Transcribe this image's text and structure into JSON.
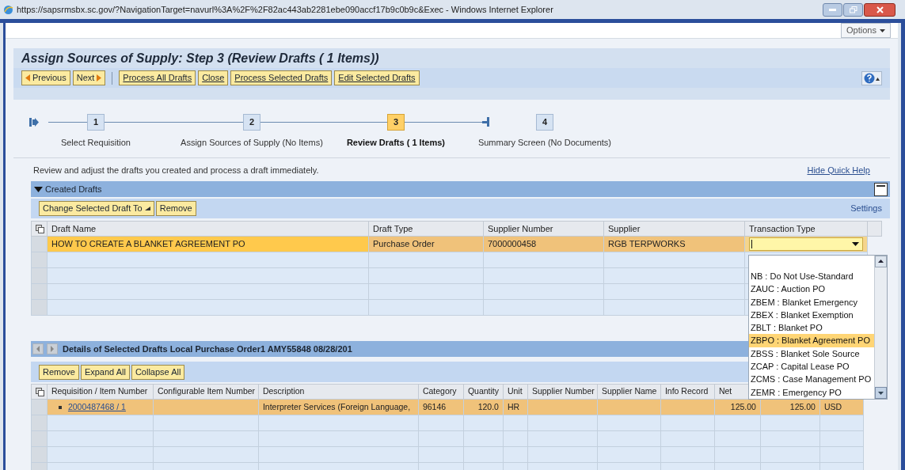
{
  "window": {
    "title": "https://sapsrmsbx.sc.gov/?NavigationTarget=navurl%3A%2F%2F82ac443ab2281ebe090accf17b9c0b9c&Exec - Windows Internet Explorer"
  },
  "options_button": "Options",
  "page_title": "Assign Sources of Supply: Step 3 (Review Drafts ( 1 Items))",
  "toolbar": [
    {
      "label": "Previous",
      "kind": "prev"
    },
    {
      "label": "Next",
      "kind": "next"
    },
    {
      "label": "Process All Drafts",
      "kind": "action"
    },
    {
      "label": "Close",
      "kind": "action"
    },
    {
      "label": "Process Selected Drafts",
      "kind": "action"
    },
    {
      "label": "Edit Selected Drafts",
      "kind": "action"
    }
  ],
  "steps": [
    {
      "number": "1",
      "label": "Select Requisition",
      "selected": false
    },
    {
      "number": "2",
      "label": "Assign Sources of Supply (No Items)",
      "selected": false
    },
    {
      "number": "3",
      "label": "Review Drafts ( 1 Items)",
      "selected": true
    },
    {
      "number": "4",
      "label": "Summary Screen (No Documents)",
      "selected": false
    }
  ],
  "quick_help": {
    "text": "Review and adjust the drafts you created and process a draft immediately.",
    "link": "Hide Quick Help"
  },
  "created_drafts": {
    "title": "Created Drafts",
    "expanded": true,
    "toolbar": [
      {
        "label": "Change Selected Draft To",
        "kind": "menu"
      },
      {
        "label": "Remove",
        "kind": "action"
      }
    ],
    "settings_link": "Settings",
    "columns": [
      "Draft Name",
      "Draft Type",
      "Supplier Number",
      "Supplier",
      "Transaction Type"
    ],
    "rows": [
      {
        "draft_name": "HOW TO CREATE A BLANKET AGREEMENT PO",
        "draft_type": "Purchase Order",
        "supplier_number": "7000000458",
        "supplier": "RGB TERPWORKS",
        "selected": true
      }
    ]
  },
  "transaction_dropdown": {
    "options": [
      {
        "label": "NB : Do Not Use-Standard",
        "selected": false
      },
      {
        "label": "ZAUC : Auction PO",
        "selected": false
      },
      {
        "label": "ZBEM : Blanket Emergency",
        "selected": false
      },
      {
        "label": "ZBEX : Blanket Exemption",
        "selected": false
      },
      {
        "label": "ZBLT : Blanket PO",
        "selected": false
      },
      {
        "label": "ZBPO : Blanket Agreement PO",
        "selected": true
      },
      {
        "label": "ZBSS : Blanket Sole Source",
        "selected": false
      },
      {
        "label": "ZCAP : Capital Lease PO",
        "selected": false
      },
      {
        "label": "ZCMS : Case Management PO",
        "selected": false
      },
      {
        "label": "ZEMR : Emergency PO",
        "selected": false
      }
    ]
  },
  "details": {
    "title": "Details of Selected Drafts Local Purchase Order1 AMY55848 08/28/201",
    "toolbar": [
      {
        "label": "Remove",
        "kind": "action"
      },
      {
        "label": "Expand All",
        "kind": "action"
      },
      {
        "label": "Collapse All",
        "kind": "action"
      }
    ],
    "columns": [
      "Requisition / Item Number",
      "Configurable Item Number",
      "Description",
      "Category",
      "Quantity",
      "Unit",
      "Supplier Number",
      "Supplier Name",
      "Info Record",
      "Net"
    ],
    "rows": [
      {
        "item_number": "2000487468 / 1",
        "description": "Interpreter Services (Foreign Language,",
        "category": "96146",
        "quantity": "120.0",
        "unit": "HR",
        "net_price": "125.00",
        "column_11": "125.00",
        "column_12": "USD",
        "selected": true
      }
    ]
  }
}
